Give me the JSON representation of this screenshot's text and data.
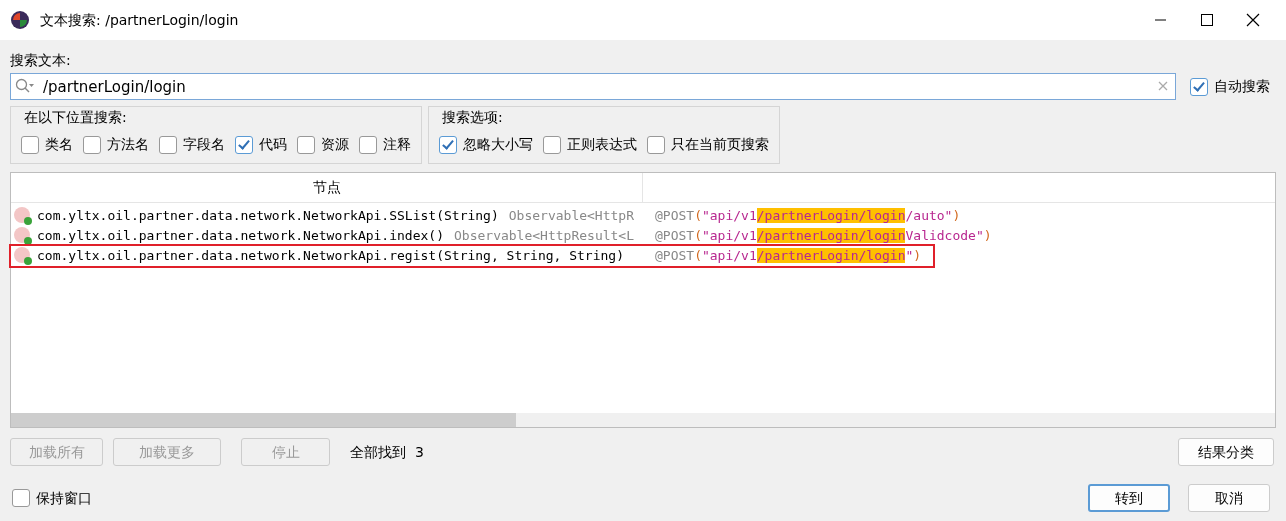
{
  "window": {
    "title": "文本搜索: /partnerLogin/login"
  },
  "search": {
    "label": "搜索文本:",
    "value": "/partnerLogin/login",
    "auto_search": {
      "label": "自动搜索",
      "checked": true
    }
  },
  "search_in": {
    "title": "在以下位置搜索:",
    "options": [
      {
        "label": "类名",
        "checked": false
      },
      {
        "label": "方法名",
        "checked": false
      },
      {
        "label": "字段名",
        "checked": false
      },
      {
        "label": "代码",
        "checked": true
      },
      {
        "label": "资源",
        "checked": false
      },
      {
        "label": "注释",
        "checked": false
      }
    ]
  },
  "search_options": {
    "title": "搜索选项:",
    "options": [
      {
        "label": "忽略大小写",
        "checked": true
      },
      {
        "label": "正则表达式",
        "checked": false
      },
      {
        "label": "只在当前页搜索",
        "checked": false
      }
    ]
  },
  "table": {
    "columns": [
      "节点"
    ],
    "rows": [
      {
        "node": "com.yltx.oil.partner.data.network.NetworkApi.SSList(String)",
        "type": "Observable<HttpR",
        "boxed": false,
        "code": [
          {
            "kind": "annotation",
            "text": "@POST"
          },
          {
            "kind": "punct",
            "text": "("
          },
          {
            "kind": "string",
            "text": "\"api/v1"
          },
          {
            "kind": "match",
            "text": "/partnerLogin/login"
          },
          {
            "kind": "string",
            "text": "/auto\""
          },
          {
            "kind": "punct",
            "text": ")"
          }
        ]
      },
      {
        "node": "com.yltx.oil.partner.data.network.NetworkApi.index()",
        "type": "Observable<HttpResult<L",
        "boxed": false,
        "code": [
          {
            "kind": "annotation",
            "text": "@POST"
          },
          {
            "kind": "punct",
            "text": "("
          },
          {
            "kind": "string",
            "text": "\"api/v1"
          },
          {
            "kind": "match",
            "text": "/partnerLogin/login"
          },
          {
            "kind": "string",
            "text": "Validcode\""
          },
          {
            "kind": "punct",
            "text": ")"
          }
        ]
      },
      {
        "node": "com.yltx.oil.partner.data.network.NetworkApi.regist(String, String, String)",
        "boxed": true,
        "code": [
          {
            "kind": "annotation",
            "text": "@POST"
          },
          {
            "kind": "punct",
            "text": "("
          },
          {
            "kind": "string",
            "text": "\"api/v1"
          },
          {
            "kind": "match",
            "text": "/partnerLogin/login"
          },
          {
            "kind": "string",
            "text": "\""
          },
          {
            "kind": "punct",
            "text": ")"
          }
        ]
      }
    ]
  },
  "actions": [
    {
      "label": "加载所有",
      "disabled": true
    },
    {
      "label": "加载更多",
      "disabled": true
    },
    {
      "label": "停止",
      "disabled": true
    }
  ],
  "found": "全部找到  3",
  "group_button": {
    "label": "结果分类"
  },
  "keep_window": {
    "label": "保持窗口",
    "checked": false
  },
  "buttons": [
    {
      "label": "转到",
      "default": true
    },
    {
      "label": "取消",
      "default": false
    }
  ]
}
